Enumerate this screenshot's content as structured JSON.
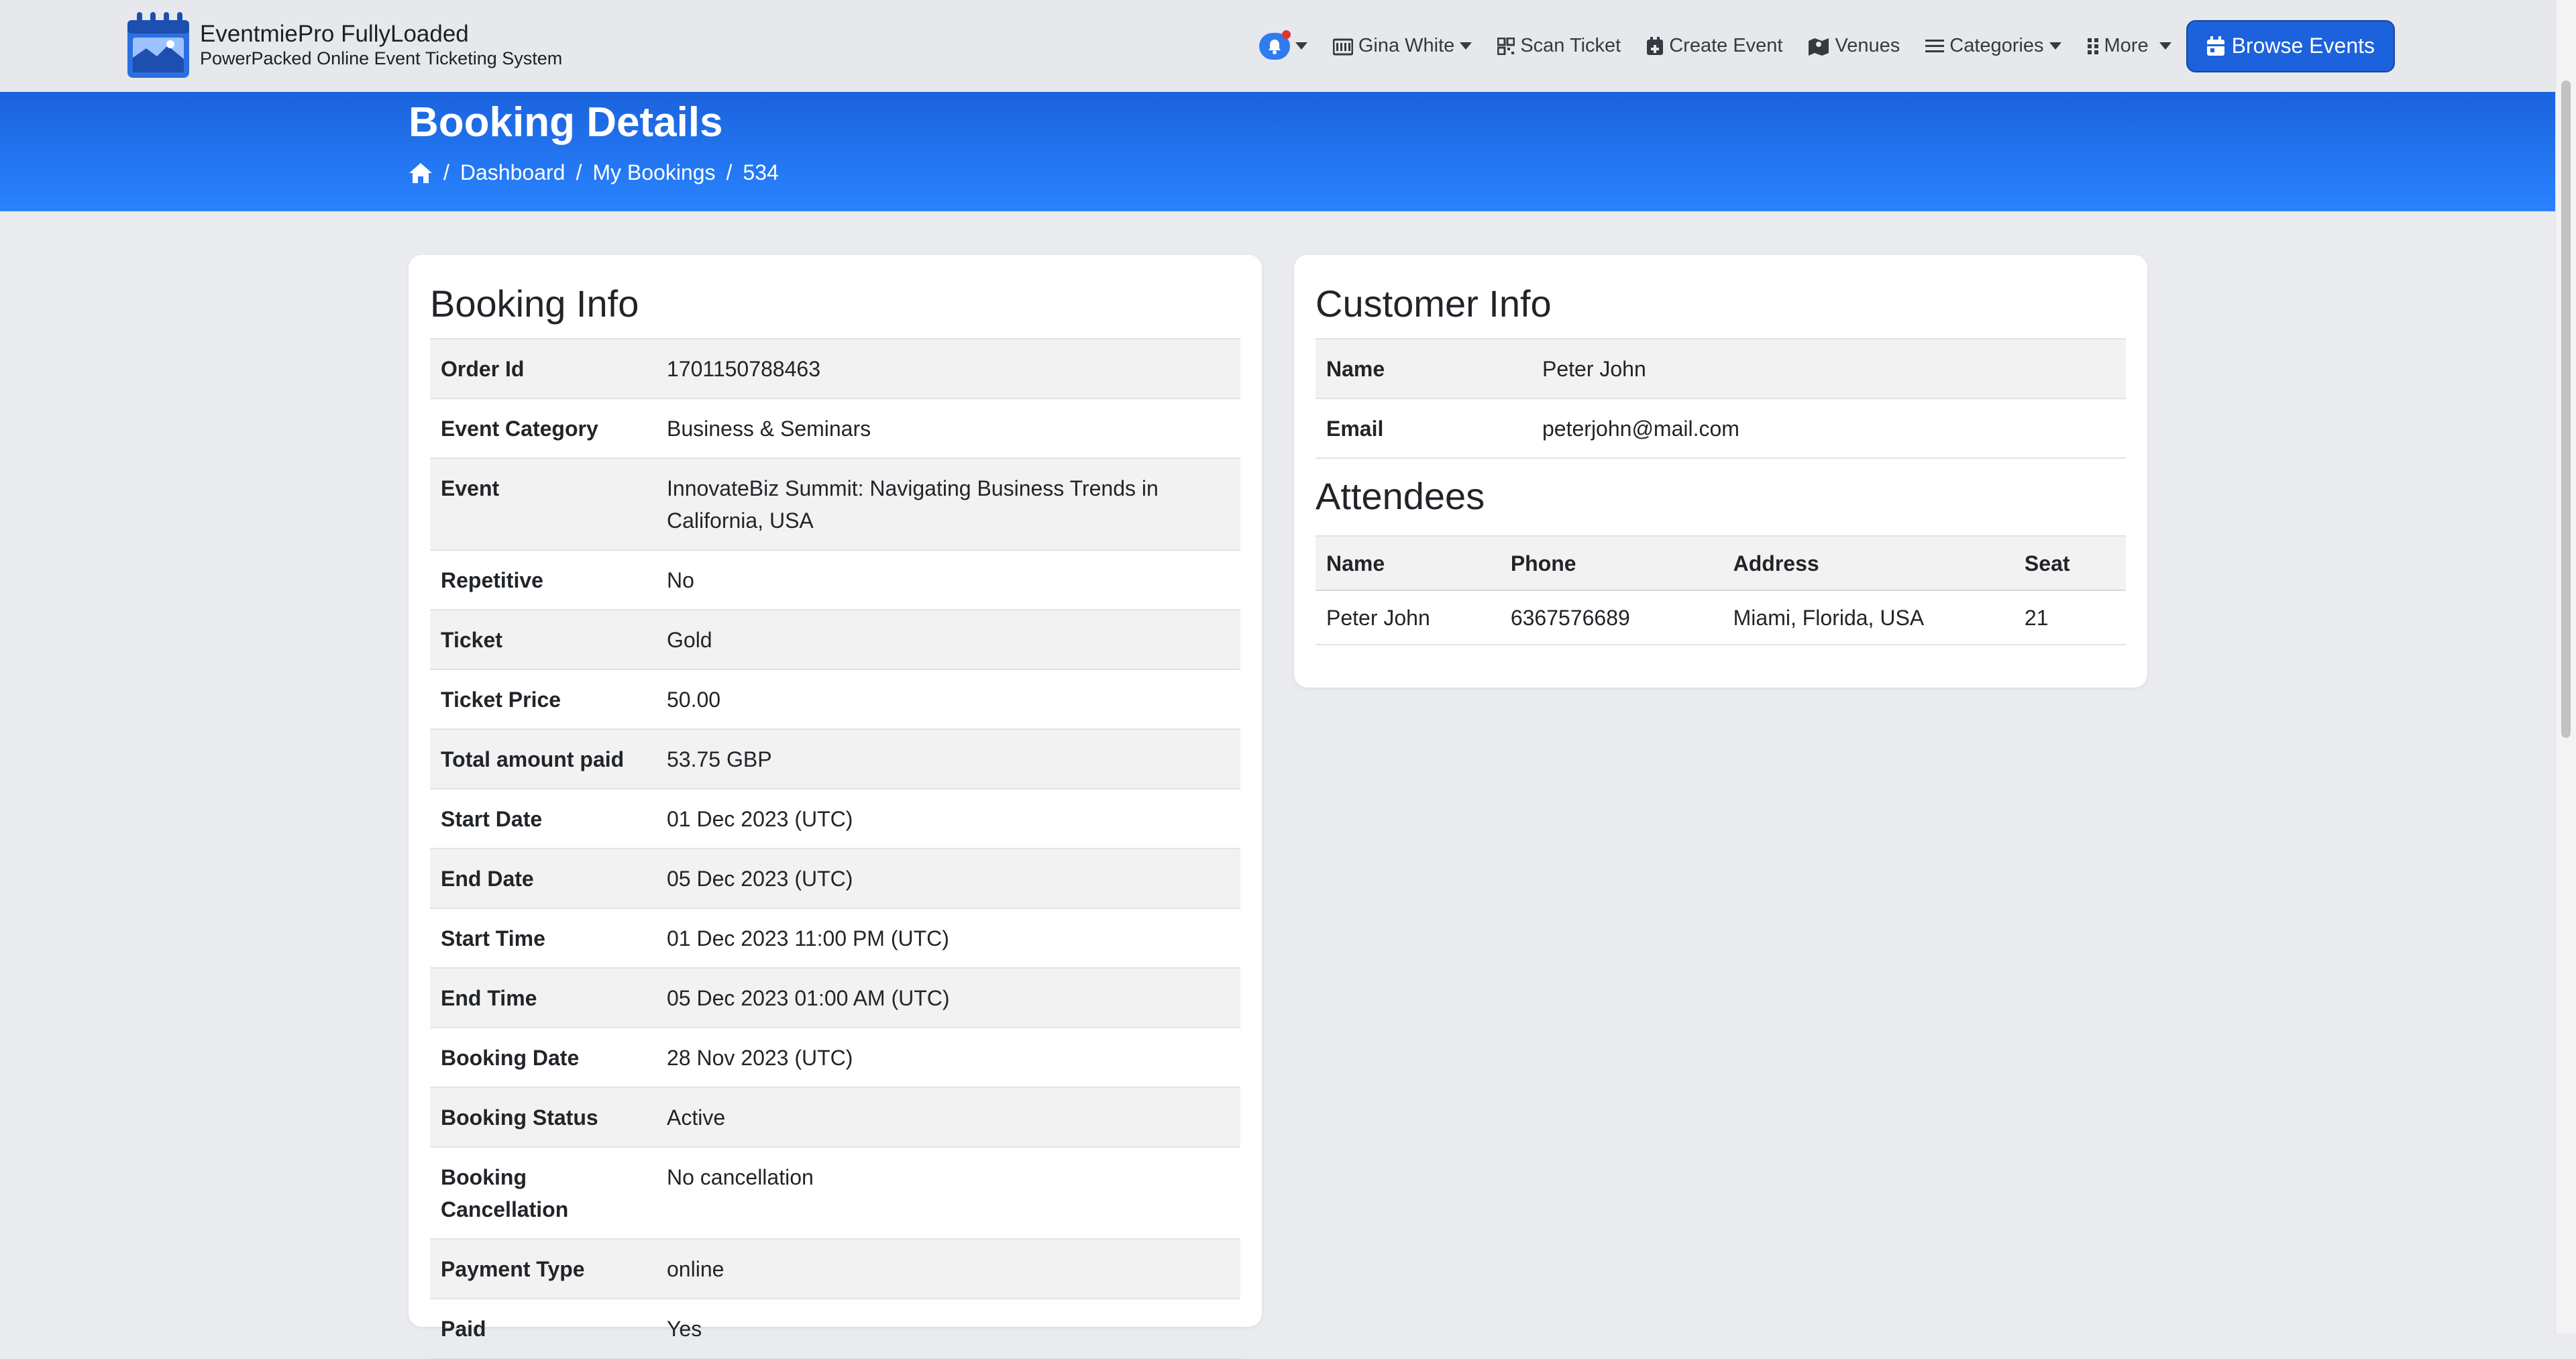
{
  "brand": {
    "title": "EventmiePro FullyLoaded",
    "subtitle": "PowerPacked Online Event Ticketing System"
  },
  "nav": {
    "user": "Gina White",
    "scan_ticket": "Scan Ticket",
    "create_event": "Create Event",
    "venues": "Venues",
    "categories": "Categories",
    "more": "More",
    "browse_events": "Browse Events"
  },
  "hero": {
    "title": "Booking Details",
    "breadcrumb": [
      "Dashboard",
      "My Bookings",
      "534"
    ]
  },
  "booking_info": {
    "title": "Booking Info",
    "rows": [
      {
        "label": "Order Id",
        "value": "1701150788463"
      },
      {
        "label": "Event Category",
        "value": "Business & Seminars"
      },
      {
        "label": "Event",
        "value": "InnovateBiz Summit: Navigating Business Trends in California, USA"
      },
      {
        "label": "Repetitive",
        "value": "No"
      },
      {
        "label": "Ticket",
        "value": "Gold"
      },
      {
        "label": "Ticket Price",
        "value": "50.00"
      },
      {
        "label": "Total amount paid",
        "value": "53.75 GBP"
      },
      {
        "label": "Start Date",
        "value": "01 Dec 2023 (UTC)"
      },
      {
        "label": "End Date",
        "value": "05 Dec 2023 (UTC)"
      },
      {
        "label": "Start Time",
        "value": "01 Dec 2023 11:00 PM (UTC)"
      },
      {
        "label": "End Time",
        "value": "05 Dec 2023 01:00 AM (UTC)"
      },
      {
        "label": "Booking Date",
        "value": "28 Nov 2023 (UTC)"
      },
      {
        "label": "Booking Status",
        "value": "Active"
      },
      {
        "label": "Booking Cancellation",
        "value": "No cancellation"
      },
      {
        "label": "Payment Type",
        "value": "online"
      },
      {
        "label": "Paid",
        "value": "Yes"
      }
    ]
  },
  "customer_info": {
    "title": "Customer Info",
    "rows": [
      {
        "label": "Name",
        "value": "Peter John"
      },
      {
        "label": "Email",
        "value": "peterjohn@mail.com"
      }
    ]
  },
  "attendees": {
    "title": "Attendees",
    "columns": [
      "Name",
      "Phone",
      "Address",
      "Seat"
    ],
    "rows": [
      [
        "Peter John",
        "6367576689",
        "Miami, Florida, USA",
        "21"
      ]
    ]
  },
  "colors": {
    "accent": "#2a83ff",
    "primary_button": "#1c62dc",
    "notification_dot": "#e0362c"
  },
  "icons": {
    "bell": "bell-icon",
    "user": "id-card-icon",
    "scan": "qr-code-icon",
    "create": "calendar-plus-icon",
    "venues": "map-icon",
    "categories": "list-icon",
    "more": "grid-dots-icon",
    "browse": "calendar-icon",
    "home": "home-icon"
  }
}
